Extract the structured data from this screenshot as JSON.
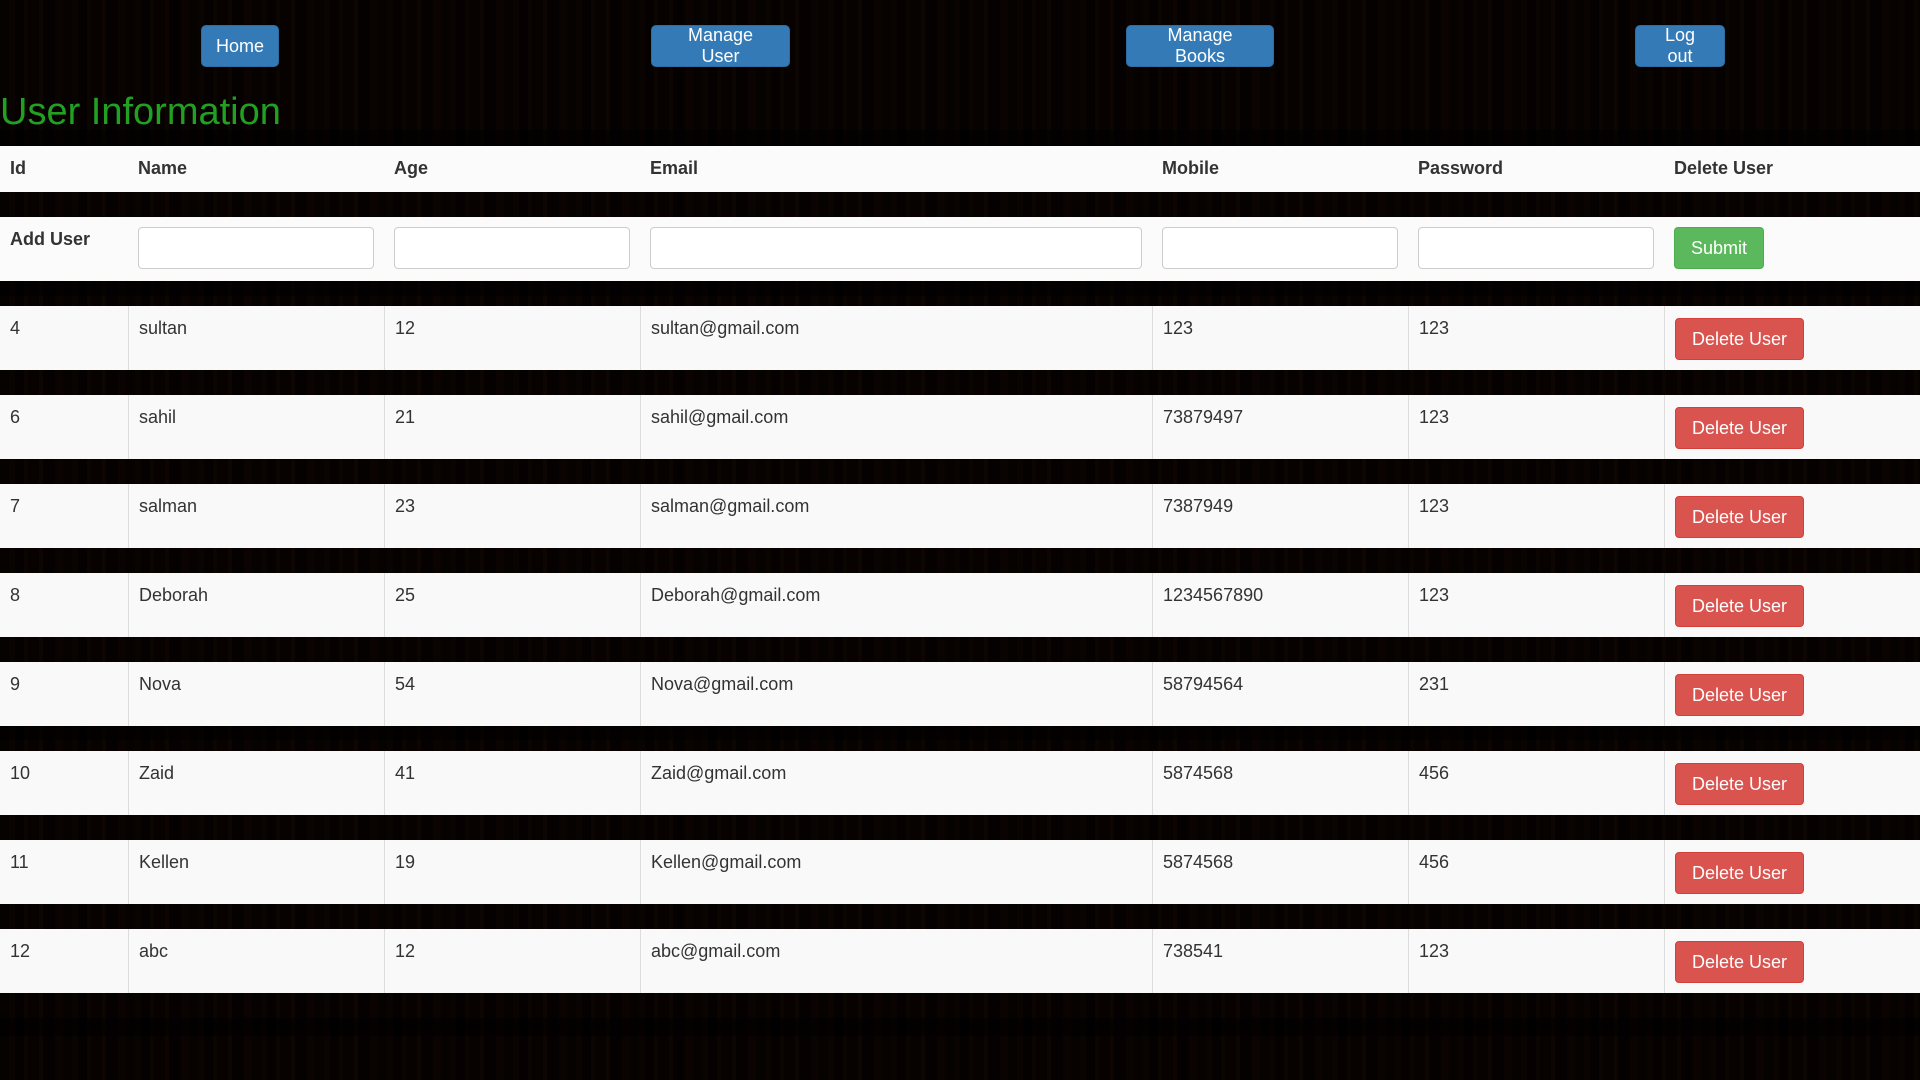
{
  "nav": {
    "home_label": "Home",
    "manage_user_label": "Manage User",
    "manage_books_label": "Manage Books",
    "logout_label": "Log out"
  },
  "page": {
    "title": "User Information",
    "title_color": "#22a022"
  },
  "table": {
    "headers": [
      "Id",
      "Name",
      "Age",
      "Email",
      "Mobile",
      "Password",
      "Delete User"
    ],
    "add_user": {
      "label": "Add User",
      "name_value": "",
      "age_value": "",
      "email_value": "",
      "mobile_value": "",
      "password_value": "",
      "submit_label": "Submit"
    },
    "delete_label": "Delete User",
    "rows": [
      {
        "id": "4",
        "name": "sultan",
        "age": "12",
        "email": "sultan@gmail.com",
        "mobile": "123",
        "password": "123"
      },
      {
        "id": "6",
        "name": "sahil",
        "age": "21",
        "email": "sahil@gmail.com",
        "mobile": "73879497",
        "password": "123"
      },
      {
        "id": "7",
        "name": "salman",
        "age": "23",
        "email": "salman@gmail.com",
        "mobile": "7387949",
        "password": "123"
      },
      {
        "id": "8",
        "name": "Deborah",
        "age": "25",
        "email": "Deborah@gmail.com",
        "mobile": "1234567890",
        "password": "123"
      },
      {
        "id": "9",
        "name": "Nova",
        "age": "54",
        "email": "Nova@gmail.com",
        "mobile": "58794564",
        "password": "231"
      },
      {
        "id": "10",
        "name": "Zaid",
        "age": "41",
        "email": "Zaid@gmail.com",
        "mobile": "5874568",
        "password": "456"
      },
      {
        "id": "11",
        "name": "Kellen",
        "age": "19",
        "email": "Kellen@gmail.com",
        "mobile": "5874568",
        "password": "456"
      },
      {
        "id": "12",
        "name": "abc",
        "age": "12",
        "email": "abc@gmail.com",
        "mobile": "738541",
        "password": "123"
      }
    ]
  },
  "colors": {
    "primary_button": "#337ab7",
    "submit_button": "#5cb85c",
    "delete_button": "#d9534f"
  }
}
